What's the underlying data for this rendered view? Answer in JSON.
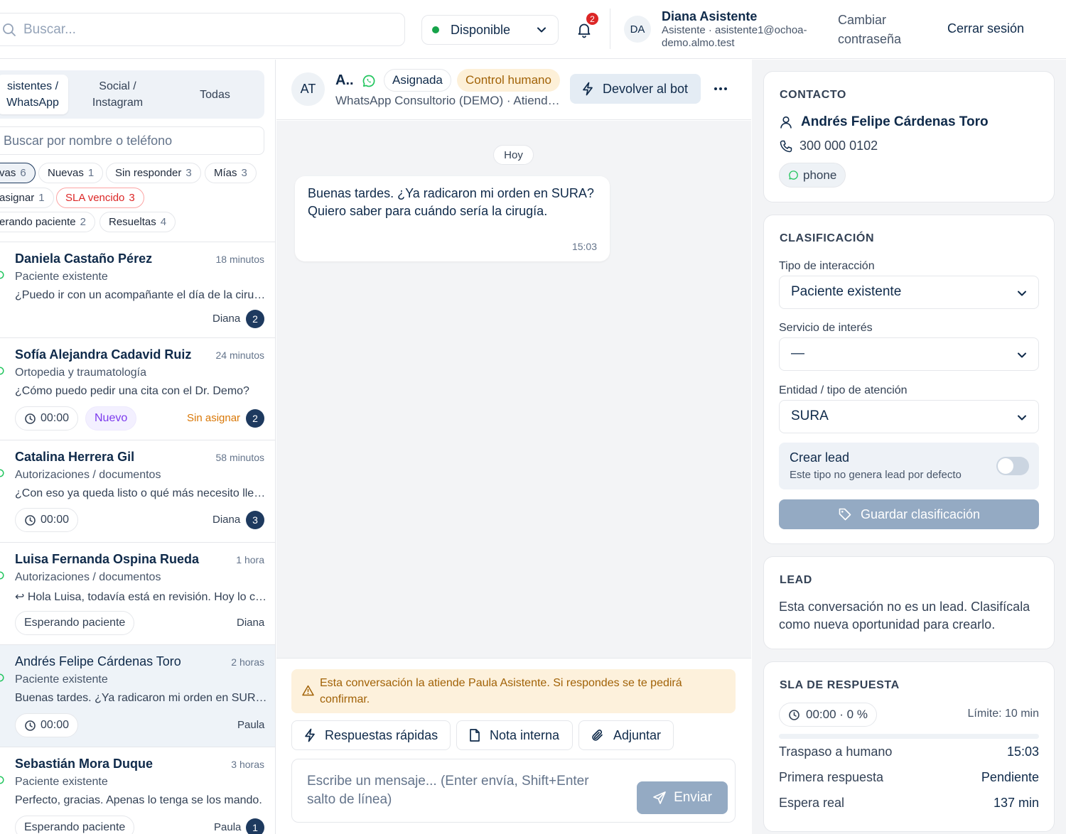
{
  "header": {
    "search_placeholder": "Buscar...",
    "status": "Disponible",
    "notification_count": "2",
    "avatar_initials": "DA",
    "user_name": "Diana Asistente",
    "user_sub": "Asistente · asistente1@ochoa-demo.almo.test",
    "change_password": "Cambiar contraseña",
    "logout": "Cerrar sesión"
  },
  "sidebar": {
    "tabs": [
      {
        "label": "sistentes / WhatsApp"
      },
      {
        "label": "Social / Instagram"
      },
      {
        "label": "Todas"
      }
    ],
    "search_placeholder": "Buscar por nombre o teléfono",
    "filters": [
      {
        "label": "vas",
        "count": "6"
      },
      {
        "label": "Nuevas",
        "count": "1"
      },
      {
        "label": "Sin responder",
        "count": "3"
      },
      {
        "label": "Mías",
        "count": "3"
      },
      {
        "label": "asignar",
        "count": "1"
      },
      {
        "label": "SLA vencido",
        "count": "3"
      },
      {
        "label": "erando paciente",
        "count": "2"
      },
      {
        "label": "Resueltas",
        "count": "4"
      }
    ],
    "conversations": [
      {
        "name": "Daniela Castaño Pérez",
        "time": "18 minutos",
        "category": "Paciente existente",
        "message": "¿Puedo ir con un acompañante el día de la cirugía?",
        "agent": "Diana",
        "count": "2"
      },
      {
        "name": "Sofía Alejandra Cadavid Ruiz",
        "time": "24 minutos",
        "category": "Ortopedia y traumatología",
        "message": "¿Cómo puedo pedir una cita con el Dr. Demo?",
        "timer": "00:00",
        "badge": "Nuevo",
        "agent": "Sin asignar",
        "count": "2"
      },
      {
        "name": "Catalina Herrera Gil",
        "time": "58 minutos",
        "category": "Autorizaciones / documentos",
        "message": "¿Con eso ya queda listo o qué más necesito llevar?",
        "timer": "00:00",
        "agent": "Diana",
        "count": "3"
      },
      {
        "name": "Luisa Fernanda Ospina Rueda",
        "time": "1 hora",
        "category": "Autorizaciones / documentos",
        "message": "↩ Hola Luisa, todavía está en revisión. Hoy lo confirmamos.",
        "status": "Esperando paciente",
        "agent": "Diana"
      },
      {
        "name": "Andrés Felipe Cárdenas Toro",
        "time": "2 horas",
        "category": "Paciente existente",
        "message": "Buenas tardes. ¿Ya radicaron mi orden en SURA?",
        "timer": "00:00",
        "agent": "Paula"
      },
      {
        "name": "Sebastián Mora Duque",
        "time": "3 horas",
        "category": "Paciente existente",
        "message": "Perfecto, gracias. Apenas lo tenga se los mando.",
        "status": "Esperando paciente",
        "agent": "Paula",
        "count": "1"
      }
    ]
  },
  "chat": {
    "avatar_initials": "AT",
    "name": "A..",
    "assigned_badge": "Asignada",
    "control_badge": "Control humano",
    "subtitle": "WhatsApp Consultorio (DEMO) · Atiende Paula Asistente",
    "return_bot": "Devolver al bot",
    "day": "Hoy",
    "message": {
      "text": "Buenas tardes. ¿Ya radicaron mi orden en SURA? Quiero saber para cuándo sería la cirugía.",
      "time": "15:03"
    },
    "warning": "Esta conversación la atiende Paula Asistente. Si respondes se te pedirá confirmar.",
    "quick_replies": "Respuestas rápidas",
    "internal_note": "Nota interna",
    "attach": "Adjuntar",
    "composer_placeholder": "Escribe un mensaje... (Enter envía, Shift+Enter salto de línea)",
    "send": "Enviar"
  },
  "contact": {
    "title": "CONTACTO",
    "name": "Andrés Felipe Cárdenas Toro",
    "phone": "300 000 0102",
    "channel": "phone"
  },
  "classification": {
    "title": "CLASIFICACIÓN",
    "interaction_label": "Tipo de interacción",
    "interaction_value": "Paciente existente",
    "service_label": "Servicio de interés",
    "service_value": "—",
    "entity_label": "Entidad / tipo de atención",
    "entity_value": "SURA",
    "lead_title": "Crear lead",
    "lead_hint": "Este tipo no genera lead por defecto",
    "lead_enabled": false,
    "save": "Guardar clasificación"
  },
  "lead": {
    "title": "LEAD",
    "text": "Esta conversación no es un lead. Clasifícala como nueva oportunidad para crearlo."
  },
  "sla": {
    "title": "SLA DE RESPUESTA",
    "timer": "00:00 · 0 %",
    "progress_percent": 0,
    "limit": "Límite: 10 min",
    "rows": [
      {
        "label": "Traspaso a humano",
        "value": "15:03"
      },
      {
        "label": "Primera respuesta",
        "value": "Pendiente"
      },
      {
        "label": "Espera real",
        "value": "137 min"
      }
    ]
  },
  "colors": {
    "navy": "#0f2a4a",
    "whatsapp": "#22c55e",
    "available": "#16a34a",
    "danger": "#dc2626",
    "warning_bg": "#fdf1dc",
    "warning_text": "#a16207",
    "disabled_button": "#94aac3"
  }
}
